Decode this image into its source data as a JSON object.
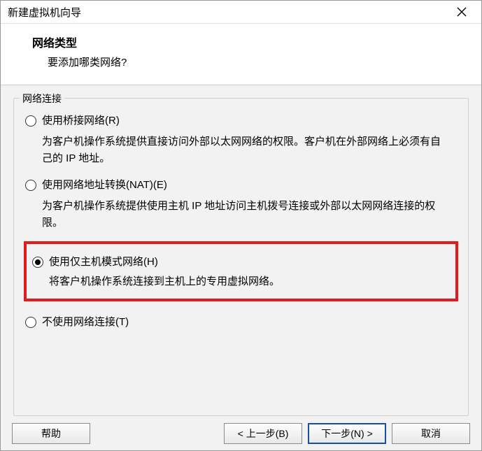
{
  "window": {
    "title": "新建虚拟机向导"
  },
  "header": {
    "title": "网络类型",
    "subtitle": "要添加哪类网络?"
  },
  "fieldset": {
    "legend": "网络连接"
  },
  "options": {
    "bridged": {
      "label": "使用桥接网络(R)",
      "desc": "为客户机操作系统提供直接访问外部以太网网络的权限。客户机在外部网络上必须有自己的 IP 地址。"
    },
    "nat": {
      "label": "使用网络地址转换(NAT)(E)",
      "desc": "为客户机操作系统提供使用主机 IP 地址访问主机拨号连接或外部以太网网络连接的权限。"
    },
    "hostonly": {
      "label": "使用仅主机模式网络(H)",
      "desc": "将客户机操作系统连接到主机上的专用虚拟网络。"
    },
    "none": {
      "label": "不使用网络连接(T)"
    }
  },
  "buttons": {
    "help": "帮助",
    "back": "< 上一步(B)",
    "next": "下一步(N) >",
    "cancel": "取消"
  }
}
